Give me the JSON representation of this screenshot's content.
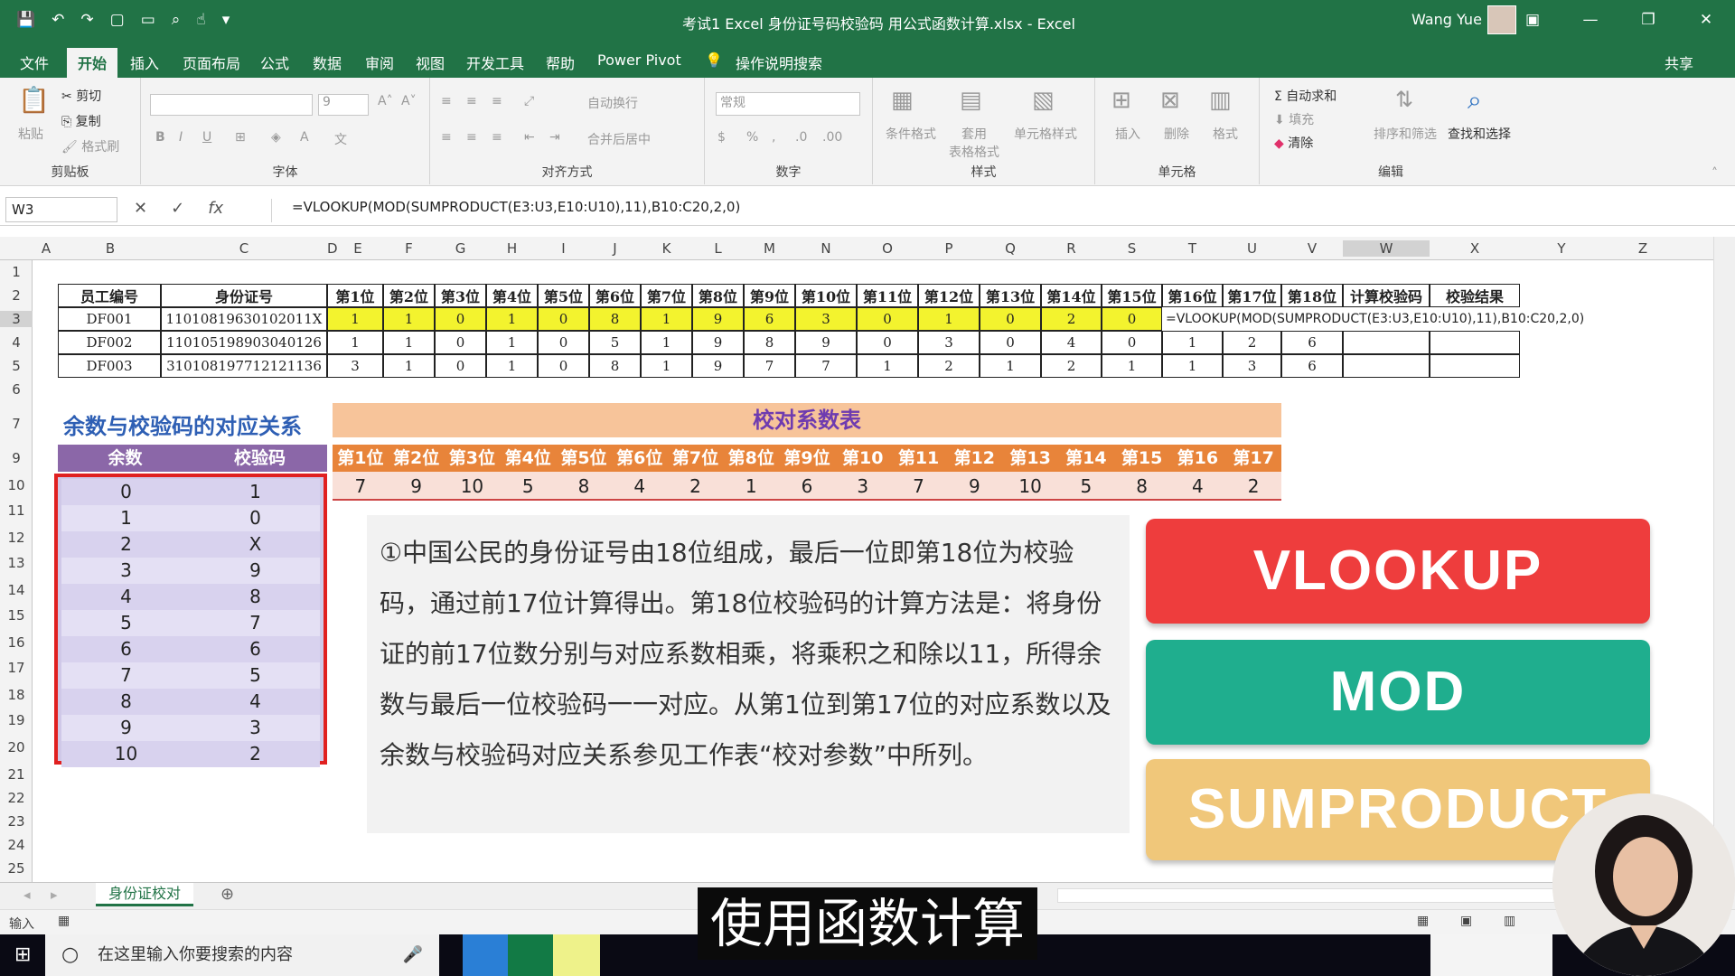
{
  "title_bar": {
    "document_title": "考试1 Excel 身份证号码校验码 用公式函数计算.xlsx  -  Excel",
    "user_name": "Wang Yue"
  },
  "ribbon_tabs": [
    "文件",
    "开始",
    "插入",
    "页面布局",
    "公式",
    "数据",
    "审阅",
    "视图",
    "开发工具",
    "帮助",
    "Power Pivot",
    "操作说明搜索"
  ],
  "share_label": "共享",
  "ribbon": {
    "clipboard": {
      "paste": "粘贴",
      "cut": "剪切",
      "copy": "复制",
      "format_painter": "格式刷",
      "label": "剪贴板"
    },
    "font": {
      "size": "9",
      "label": "字体"
    },
    "alignment": {
      "wrap": "自动换行",
      "merge": "合并后居中",
      "label": "对齐方式"
    },
    "number": {
      "format": "常规",
      "label": "数字"
    },
    "styles": {
      "conditional": "条件格式",
      "table_format": "套用\n表格格式",
      "cell_styles": "单元格样式",
      "label": "样式"
    },
    "cells": {
      "insert": "插入",
      "delete": "删除",
      "format": "格式",
      "label": "单元格"
    },
    "editing": {
      "autosum": "自动求和",
      "fill": "填充",
      "clear": "清除",
      "sort_filter": "排序和筛选",
      "find_select": "查找和选择",
      "label": "编辑"
    }
  },
  "formula_bar": {
    "name_box": "W3",
    "formula": "=VLOOKUP(MOD(SUMPRODUCT(E3:U3,E10:U10),11),B10:C20,2,0)"
  },
  "columns": [
    "A",
    "B",
    "C",
    "D",
    "E",
    "F",
    "G",
    "H",
    "I",
    "J",
    "K",
    "L",
    "M",
    "N",
    "O",
    "P",
    "Q",
    "R",
    "S",
    "T",
    "U",
    "V",
    "W",
    "X",
    "Y",
    "Z"
  ],
  "rows": [
    "1",
    "2",
    "3",
    "4",
    "5",
    "6",
    "7",
    "9",
    "10",
    "11",
    "12",
    "13",
    "14",
    "15",
    "16",
    "17",
    "18",
    "19",
    "20",
    "21",
    "22",
    "23",
    "24",
    "25"
  ],
  "main_table": {
    "headers": [
      "员工编号",
      "身份证号",
      "第1位",
      "第2位",
      "第3位",
      "第4位",
      "第5位",
      "第6位",
      "第7位",
      "第8位",
      "第9位",
      "第10位",
      "第11位",
      "第12位",
      "第13位",
      "第14位",
      "第15位",
      "第16位",
      "第17位",
      "第18位",
      "计算校验码",
      "校验结果"
    ],
    "rows": [
      {
        "id": "DF001",
        "idno": "11010819630102011X",
        "digits": [
          "1",
          "1",
          "0",
          "1",
          "0",
          "8",
          "1",
          "9",
          "6",
          "3",
          "0",
          "1",
          "0",
          "2",
          "0"
        ],
        "editing": "=VLOOKUP(MOD(SUMPRODUCT(E3:U3,E10:U10),11),B10:C20,2,0)"
      },
      {
        "id": "DF002",
        "idno": "110105198903040126",
        "digits": [
          "1",
          "1",
          "0",
          "1",
          "0",
          "5",
          "1",
          "9",
          "8",
          "9",
          "0",
          "3",
          "0",
          "4",
          "0",
          "1",
          "2",
          "6"
        ]
      },
      {
        "id": "DF003",
        "idno": "310108197712121136",
        "digits": [
          "3",
          "1",
          "0",
          "1",
          "0",
          "8",
          "1",
          "9",
          "7",
          "7",
          "1",
          "2",
          "1",
          "2",
          "1",
          "1",
          "3",
          "6"
        ]
      }
    ]
  },
  "remainder_section": {
    "title": "余数与校验码的对应关系",
    "headers": [
      "余数",
      "校验码"
    ],
    "rows": [
      [
        "0",
        "1"
      ],
      [
        "1",
        "0"
      ],
      [
        "2",
        "X"
      ],
      [
        "3",
        "9"
      ],
      [
        "4",
        "8"
      ],
      [
        "5",
        "7"
      ],
      [
        "6",
        "6"
      ],
      [
        "7",
        "5"
      ],
      [
        "8",
        "4"
      ],
      [
        "9",
        "3"
      ],
      [
        "10",
        "2"
      ]
    ]
  },
  "coefficient_section": {
    "title": "校对系数表",
    "headers": [
      "第1位",
      "第2位",
      "第3位",
      "第4位",
      "第5位",
      "第6位",
      "第7位",
      "第8位",
      "第9位",
      "第10位",
      "第11位",
      "第12位",
      "第13位",
      "第14位",
      "第15位",
      "第16位",
      "第17位"
    ],
    "values": [
      "7",
      "9",
      "10",
      "5",
      "8",
      "4",
      "2",
      "1",
      "6",
      "3",
      "7",
      "9",
      "10",
      "5",
      "8",
      "4",
      "2"
    ]
  },
  "note_text": "①中国公民的身份证号由18位组成，最后一位即第18位为校验码，通过前17位计算得出。第18位校验码的计算方法是：将身份证的前17位数分别与对应系数相乘，将乘积之和除以11，所得余数与最后一位校验码一一对应。从第1位到第17位的对应系数以及余数与校验码对应关系参见工作表“校对参数”中所列。",
  "function_buttons": [
    {
      "label": "VLOOKUP",
      "color": "#ee3d3d"
    },
    {
      "label": "MOD",
      "color": "#1fae8e"
    },
    {
      "label": "SUMPRODUCT",
      "color": "#f0c77a"
    }
  ],
  "sheet_tab": "身份证校对",
  "status": {
    "mode": "输入"
  },
  "taskbar": {
    "search_placeholder": "在这里输入你要搜索的内容"
  },
  "subtitle": "使用函数计算"
}
